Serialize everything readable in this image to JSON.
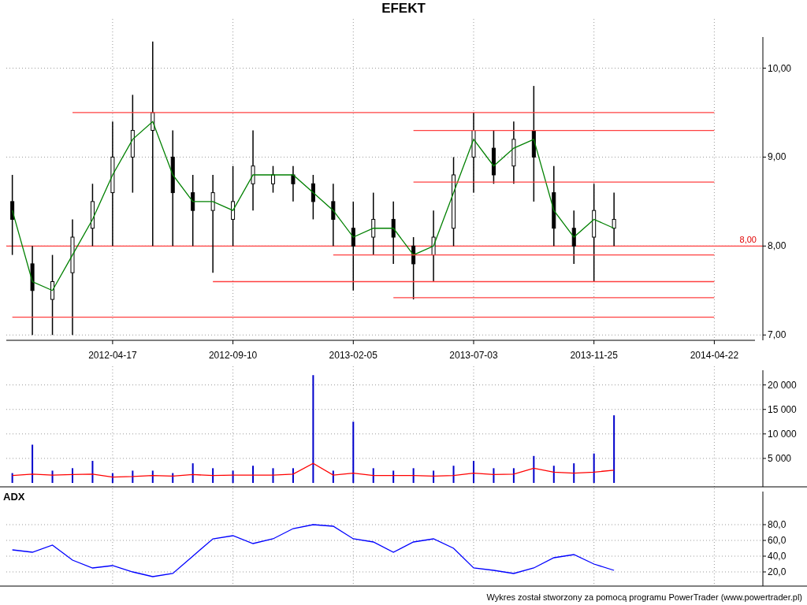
{
  "title": "EFEKT",
  "price_chart": {
    "chart_data": {
      "type": "candlestick",
      "grid": true,
      "categories": [
        null,
        null,
        null,
        null,
        null,
        "2012-04-17",
        null,
        null,
        null,
        null,
        null,
        "2012-09-10",
        null,
        null,
        null,
        null,
        null,
        "2013-02-05",
        null,
        null,
        null,
        null,
        null,
        "2013-07-03",
        null,
        null,
        null,
        null,
        null,
        "2013-11-25",
        null,
        null,
        null,
        null,
        null,
        "2014-04-22",
        null,
        null
      ],
      "series": [
        {
          "color": "#000000",
          "ohlc": [
            [
              8.5,
              8.8,
              7.9,
              8.3
            ],
            [
              7.8,
              8.0,
              7.0,
              7.5
            ],
            [
              7.4,
              7.9,
              7.0,
              7.6
            ],
            [
              7.7,
              8.3,
              7.0,
              8.1
            ],
            [
              8.2,
              8.7,
              8.0,
              8.5
            ],
            [
              8.6,
              9.4,
              8.0,
              9.0
            ],
            [
              9.0,
              9.7,
              8.6,
              9.3
            ],
            [
              9.3,
              10.3,
              8.0,
              9.5
            ],
            [
              9.0,
              9.3,
              8.0,
              8.6
            ],
            [
              8.6,
              8.8,
              8.0,
              8.4
            ],
            [
              8.4,
              8.8,
              7.7,
              8.6
            ],
            [
              8.3,
              8.9,
              8.0,
              8.5
            ],
            [
              8.7,
              9.3,
              8.4,
              8.9
            ],
            [
              8.7,
              8.9,
              8.6,
              8.8
            ],
            [
              8.8,
              8.9,
              8.5,
              8.7
            ],
            [
              8.7,
              8.8,
              8.3,
              8.5
            ],
            [
              8.5,
              8.7,
              8.0,
              8.3
            ],
            [
              8.2,
              8.5,
              7.5,
              8.0
            ],
            [
              8.1,
              8.6,
              7.9,
              8.3
            ],
            [
              8.3,
              8.5,
              7.8,
              8.1
            ],
            [
              8.0,
              8.1,
              7.4,
              7.8
            ],
            [
              7.9,
              8.4,
              7.6,
              8.1
            ],
            [
              8.2,
              9.0,
              8.0,
              8.8
            ],
            [
              9.0,
              9.5,
              8.6,
              9.3
            ],
            [
              9.1,
              9.3,
              8.7,
              8.8
            ],
            [
              8.9,
              9.4,
              8.7,
              9.2
            ],
            [
              9.3,
              9.8,
              8.5,
              9.0
            ],
            [
              8.6,
              8.9,
              8.0,
              8.2
            ],
            [
              8.2,
              8.4,
              7.8,
              8.0
            ],
            [
              8.1,
              8.7,
              7.6,
              8.4
            ],
            [
              8.2,
              8.6,
              8.0,
              8.3
            ],
            null,
            null,
            null,
            null,
            null,
            null,
            null
          ]
        },
        {
          "type": "line",
          "color": "#008000",
          "values": [
            8.4,
            7.6,
            7.5,
            7.9,
            8.3,
            8.8,
            9.2,
            9.4,
            8.8,
            8.5,
            8.5,
            8.4,
            8.8,
            8.8,
            8.8,
            8.6,
            8.4,
            8.1,
            8.2,
            8.2,
            7.9,
            8.0,
            8.6,
            9.2,
            8.9,
            9.1,
            9.2,
            8.4,
            8.1,
            8.3,
            8.2,
            null,
            null,
            null,
            null,
            null,
            null,
            null
          ]
        },
        {
          "type": "line",
          "color": "#ff4040",
          "values": [
            null,
            null,
            null,
            9.5,
            9.5,
            9.5,
            9.5,
            9.5,
            9.5,
            9.5,
            9.5,
            9.5,
            9.5,
            9.5,
            9.5,
            9.5,
            9.5,
            9.5,
            9.5,
            9.5,
            9.5,
            9.5,
            9.5,
            9.5,
            9.5,
            9.5,
            9.5,
            9.5,
            9.5,
            9.5,
            9.5,
            9.5,
            9.5,
            9.5,
            9.5,
            9.5,
            null,
            null
          ]
        },
        {
          "type": "line",
          "color": "#ff4040",
          "values": [
            null,
            null,
            null,
            null,
            null,
            null,
            null,
            null,
            null,
            null,
            null,
            null,
            null,
            null,
            null,
            null,
            null,
            null,
            null,
            null,
            9.3,
            9.3,
            9.3,
            9.3,
            9.3,
            9.3,
            9.3,
            9.3,
            9.3,
            9.3,
            9.3,
            9.3,
            9.3,
            9.3,
            9.3,
            9.3,
            null,
            null
          ]
        },
        {
          "type": "line",
          "color": "#ff4040",
          "values": [
            null,
            null,
            null,
            null,
            null,
            null,
            null,
            null,
            null,
            null,
            null,
            null,
            null,
            null,
            null,
            null,
            null,
            null,
            null,
            null,
            8.72,
            8.72,
            8.72,
            8.72,
            8.72,
            8.72,
            8.72,
            8.72,
            8.72,
            8.72,
            8.72,
            8.72,
            8.72,
            8.72,
            8.72,
            8.72,
            null,
            null
          ]
        },
        {
          "type": "line",
          "color": "#ff4040",
          "values": [
            null,
            null,
            null,
            null,
            null,
            null,
            null,
            null,
            null,
            null,
            null,
            null,
            null,
            null,
            null,
            null,
            7.9,
            7.9,
            7.9,
            7.9,
            7.9,
            7.9,
            7.9,
            7.9,
            7.9,
            7.9,
            7.9,
            7.9,
            7.9,
            7.9,
            7.9,
            7.9,
            7.9,
            7.9,
            7.9,
            7.9,
            null,
            null
          ]
        },
        {
          "type": "line",
          "color": "#ff4040",
          "values": [
            null,
            null,
            null,
            null,
            null,
            null,
            null,
            null,
            null,
            null,
            7.6,
            7.6,
            7.6,
            7.6,
            7.6,
            7.6,
            7.6,
            7.6,
            7.6,
            7.6,
            7.6,
            7.6,
            7.6,
            7.6,
            7.6,
            7.6,
            7.6,
            7.6,
            7.6,
            7.6,
            7.6,
            7.6,
            7.6,
            7.6,
            7.6,
            7.6,
            null,
            null
          ]
        },
        {
          "type": "line",
          "color": "#ff4040",
          "values": [
            null,
            null,
            null,
            null,
            null,
            null,
            null,
            null,
            null,
            null,
            null,
            null,
            null,
            null,
            null,
            null,
            null,
            null,
            null,
            7.42,
            7.42,
            7.42,
            7.42,
            7.42,
            7.42,
            7.42,
            7.42,
            7.42,
            7.42,
            7.42,
            7.42,
            7.42,
            7.42,
            7.42,
            7.42,
            7.42,
            null,
            null
          ]
        },
        {
          "type": "line",
          "color": "#ff4040",
          "values": [
            7.2,
            7.2,
            7.2,
            7.2,
            7.2,
            7.2,
            7.2,
            7.2,
            7.2,
            7.2,
            7.2,
            7.2,
            7.2,
            7.2,
            7.2,
            7.2,
            7.2,
            7.2,
            7.2,
            7.2,
            7.2,
            7.2,
            7.2,
            7.2,
            7.2,
            7.2,
            7.2,
            7.2,
            7.2,
            7.2,
            7.2,
            7.2,
            7.2,
            7.2,
            7.2,
            7.2,
            null,
            null
          ]
        }
      ],
      "ylim": [
        6.94,
        10.35
      ],
      "yticks": [
        {
          "value": 7,
          "label": "7,00"
        },
        {
          "value": 8,
          "label": "8,00"
        },
        {
          "value": 9,
          "label": "9,00"
        },
        {
          "value": 10,
          "label": "10,00"
        }
      ],
      "ref_lines": [
        {
          "axis": "y",
          "value": 8.0,
          "label": "8,00"
        }
      ]
    }
  },
  "volume_chart": {
    "chart_data": {
      "type": "bar",
      "grid": true,
      "series": [
        {
          "color": "#0000cc",
          "values": [
            2000,
            7800,
            2500,
            3000,
            4500,
            2000,
            2500,
            2500,
            2000,
            4000,
            3000,
            2500,
            3500,
            3000,
            3000,
            22000,
            2500,
            12500,
            3000,
            2500,
            3000,
            2500,
            3500,
            4500,
            3000,
            3000,
            5500,
            3500,
            4000,
            6000,
            13800,
            null,
            null,
            null,
            null,
            null,
            null,
            null
          ]
        },
        {
          "type": "line",
          "color": "#ff0000",
          "values": [
            1500,
            1800,
            1600,
            1700,
            1800,
            1200,
            1300,
            1500,
            1400,
            1700,
            1500,
            1600,
            1600,
            1600,
            1800,
            4000,
            1600,
            2000,
            1500,
            1500,
            1500,
            1400,
            1500,
            2000,
            1700,
            1800,
            3000,
            2200,
            2000,
            2200,
            2600,
            null,
            null,
            null,
            null,
            null,
            null,
            null
          ]
        }
      ],
      "ylim": [
        0,
        23000
      ],
      "yticks": [
        {
          "value": 5000,
          "label": "5 000"
        },
        {
          "value": 10000,
          "label": "10 000"
        },
        {
          "value": 15000,
          "label": "15 000"
        },
        {
          "value": 20000,
          "label": "20 000"
        }
      ]
    }
  },
  "adx_chart": {
    "title": "ADX",
    "chart_data": {
      "type": "line",
      "grid": true,
      "series": [
        {
          "color": "#0000ff",
          "values": [
            48,
            45,
            54,
            35,
            25,
            28,
            20,
            14,
            18,
            40,
            62,
            66,
            56,
            62,
            75,
            80,
            78,
            62,
            58,
            45,
            58,
            62,
            50,
            25,
            22,
            18,
            25,
            38,
            42,
            30,
            22,
            null,
            null,
            null,
            null,
            null,
            null,
            null
          ]
        }
      ],
      "ylim": [
        0,
        126
      ],
      "yticks": [
        {
          "value": 20,
          "label": "20,0"
        },
        {
          "value": 40,
          "label": "40,0"
        },
        {
          "value": 60,
          "label": "60,0"
        },
        {
          "value": 80,
          "label": "80,0"
        }
      ]
    }
  },
  "footer": "Wykres został stworzony za pomocą programu PowerTrader (www.powertrader.pl)"
}
